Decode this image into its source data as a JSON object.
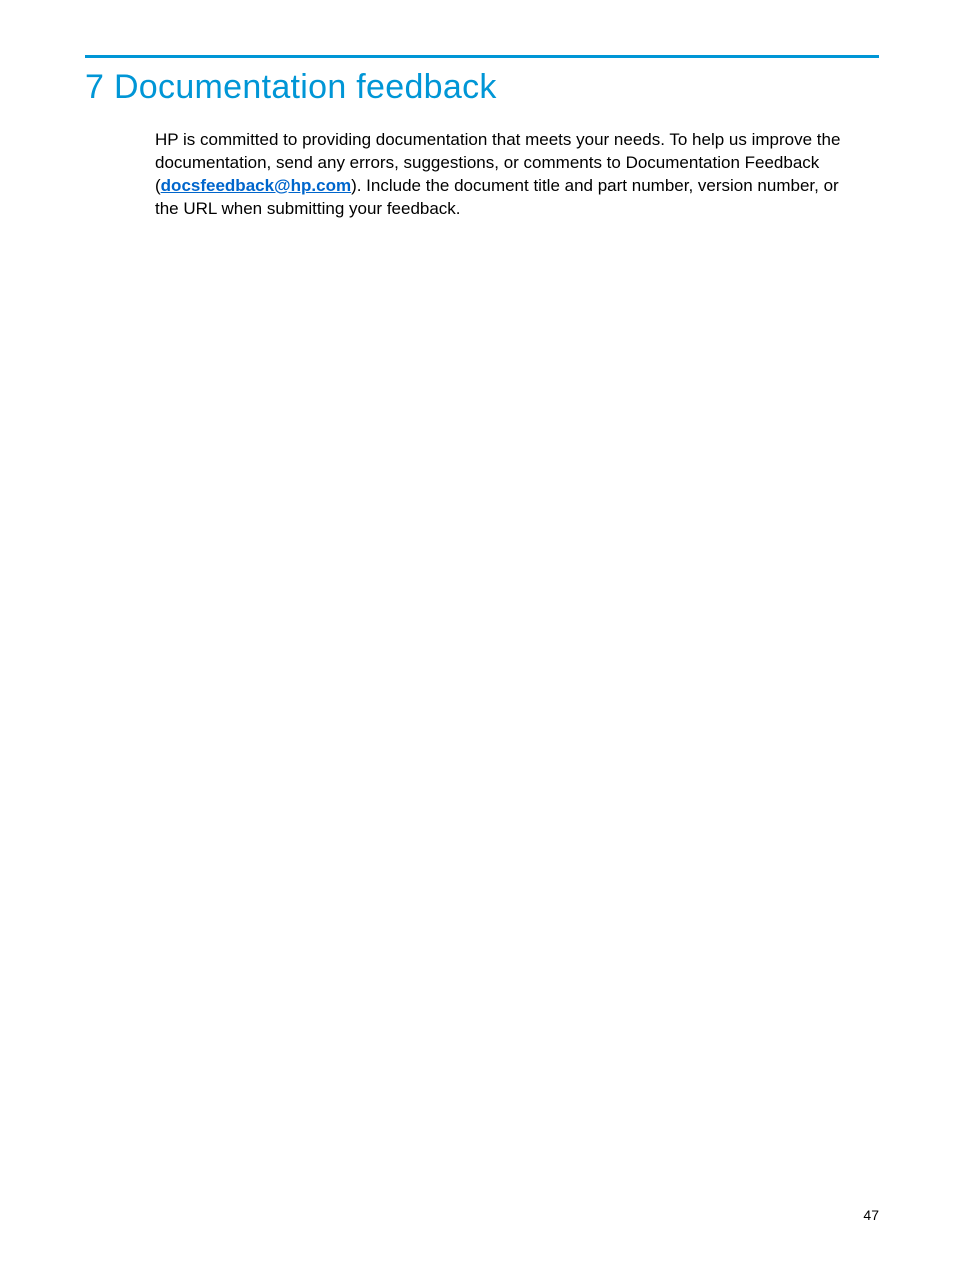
{
  "heading": "7 Documentation feedback",
  "paragraph": {
    "part1": "HP is committed to providing documentation that meets your needs. To help us improve the documentation, send any errors, suggestions, or comments to Documentation Feedback (",
    "email": "docsfeedback@hp.com",
    "part2": "). Include the document title and part number, version number, or the URL when submitting your feedback."
  },
  "page_number": "47"
}
